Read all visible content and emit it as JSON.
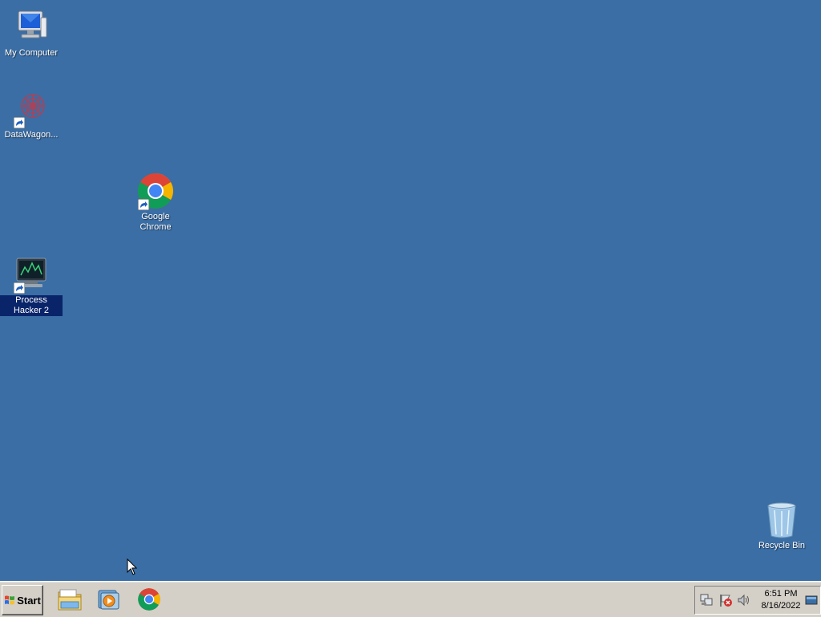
{
  "desktop": {
    "icons": [
      {
        "label": "My Computer"
      },
      {
        "label": "DataWagon..."
      },
      {
        "label": "Google Chrome"
      },
      {
        "label": "Process Hacker 2"
      },
      {
        "label": "Recycle Bin"
      }
    ],
    "background_color": "#3a6ea5"
  },
  "taskbar": {
    "start_label": "Start",
    "quick_launch": [
      {
        "icon": "file-explorer-icon"
      },
      {
        "icon": "media-player-icon"
      },
      {
        "icon": "chrome-icon"
      }
    ],
    "tray": {
      "icons": [
        "network-icon",
        "action-center-flag-icon",
        "volume-icon",
        "show-desktop-icon"
      ],
      "time": "6:51 PM",
      "date": "8/16/2022"
    }
  }
}
